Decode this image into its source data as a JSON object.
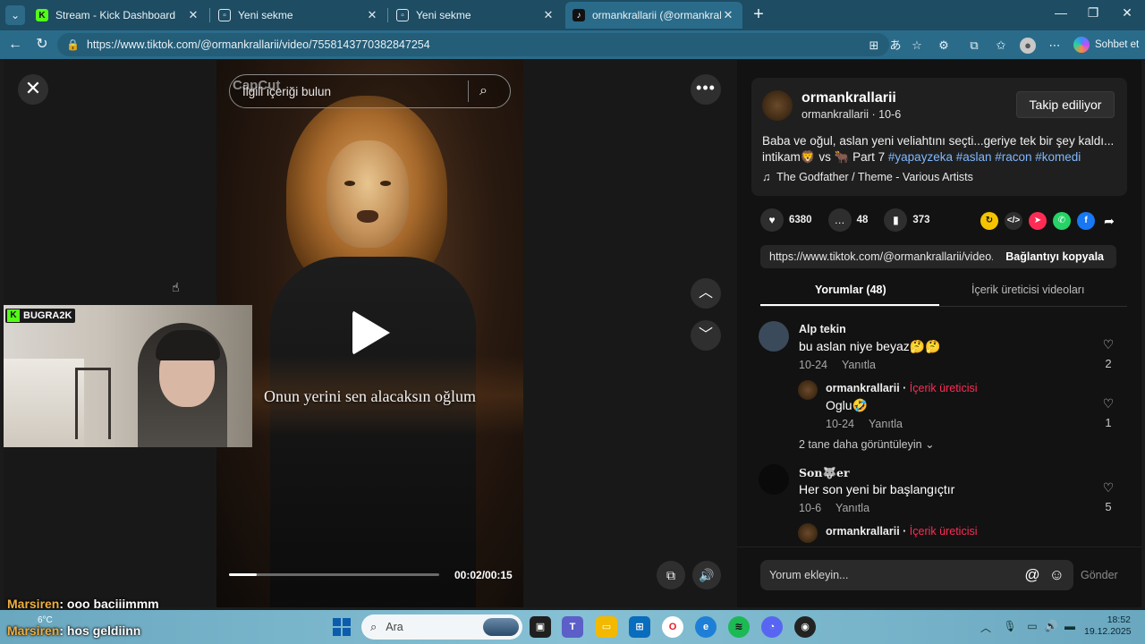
{
  "browser": {
    "tabs": [
      {
        "title": "Stream - Kick Dashboard",
        "icon": "kick-icon",
        "active": false
      },
      {
        "title": "Yeni sekme",
        "icon": "new-tab-page-icon",
        "active": false
      },
      {
        "title": "Yeni sekme",
        "icon": "new-tab-page-icon",
        "active": false
      },
      {
        "title": "ormankrallarii (@ormankrallarii) | T",
        "icon": "tiktok-icon",
        "active": true
      }
    ],
    "address": "https://www.tiktok.com/@ormankrallarii/video/7558143770382847254",
    "copilot_label": "Sohbet et",
    "colors": {
      "tabstrip": "#1d4c63",
      "toolbar": "#2a6b8a"
    }
  },
  "video": {
    "watermark": "CapCut",
    "search_placeholder": "İlgili içeriği bulun",
    "subtitle": "Onun yerini sen alacaksın oğlum",
    "time": "00:02/00:15",
    "progress": 0.13
  },
  "webcam": {
    "label": "BUGRA2K"
  },
  "post": {
    "username": "ormankrallarii",
    "sub": "ormankrallarii · 10-6",
    "follow_label": "Takip ediliyor",
    "desc_prefix": "Baba ve oğul, aslan yeni veliahtını seçti...geriye tek bir şey kaldı... intikam🦁 vs 🐂 Part 7 ",
    "hashtags": "#yapayzeka #aslan #racon #komedi",
    "music": "The Godfather / Theme - Various Artists",
    "likes": "6380",
    "comments": "48",
    "saves": "373",
    "link": "https://www.tiktok.com/@ormankrallarii/video...",
    "copy_label": "Bağlantıyı kopyala",
    "tab_comments": "Yorumlar (48)",
    "tab_creator": "İçerik üreticisi videoları",
    "share_colors": [
      "#f5c400",
      "#2e2e2e",
      "#fe2c55",
      "#25d366",
      "#1877f2"
    ]
  },
  "comments": [
    {
      "user": "Alp tekin",
      "text": "bu aslan niye beyaz🤔🤔",
      "date": "10-24",
      "reply": "Yanıtla",
      "likes": "2"
    },
    {
      "user": "ormankrallarii",
      "creator": "İçerik üreticisi",
      "text": "Oglu🤣",
      "date": "10-24",
      "reply": "Yanıtla",
      "likes": "1"
    },
    {
      "view_more": "2 tane daha görüntüleyin"
    },
    {
      "user": "Son🐺er",
      "text": "Her son yeni bir başlangıçtır",
      "date": "10-6",
      "reply": "Yanıtla",
      "likes": "5"
    },
    {
      "user": "ormankrallarii",
      "creator": "İçerik üreticisi"
    }
  ],
  "comment_input": {
    "placeholder": "Yorum ekleyin...",
    "send": "Gönder"
  },
  "chat": [
    {
      "user": "Marsiren",
      "text": ": ooo baciiimmm"
    },
    {
      "user": "Marsiren",
      "text": ": hos geldiinn"
    }
  ],
  "taskbar": {
    "temperature": "6°C",
    "search_placeholder": "Ara",
    "time": "18:52",
    "date": "19.12.2025"
  }
}
